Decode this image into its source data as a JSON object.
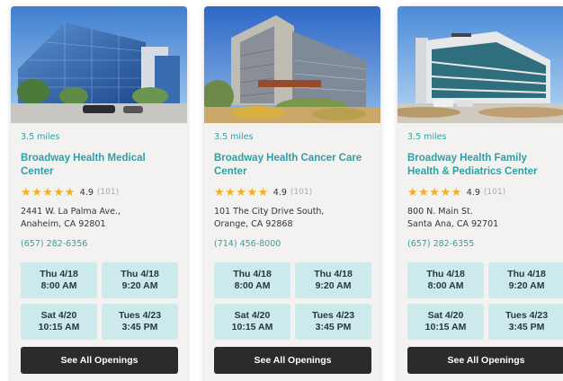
{
  "colors": {
    "accent": "#2f9fa6",
    "slot_bg": "#cce9ec",
    "star": "#f2b01e",
    "button_bg": "#2b2b2b"
  },
  "cards": [
    {
      "image": "building-photo",
      "distance": "3.5 miles",
      "name": "Broadway Health Medical Center",
      "stars": "★★★★★",
      "rating": "4.9",
      "reviews": "(101)",
      "address_line1": "2441 W. La Palma Ave.,",
      "address_line2": "Anaheim, CA 92801",
      "phone": "(657) 282-6356",
      "slots": [
        {
          "day": "Thu 4/18",
          "time": "8:00 AM"
        },
        {
          "day": "Thu 4/18",
          "time": "9:20 AM"
        },
        {
          "day": "Sat 4/20",
          "time": "10:15 AM"
        },
        {
          "day": "Tues 4/23",
          "time": "3:45 PM"
        }
      ],
      "button": "See All Openings"
    },
    {
      "image": "building-photo",
      "distance": "3.5 miles",
      "name": "Broadway Health Cancer Care Center",
      "stars": "★★★★★",
      "rating": "4.9",
      "reviews": "(101)",
      "address_line1": "101 The City Drive South,",
      "address_line2": "Orange, CA 92868",
      "phone": "(714) 456-8000",
      "slots": [
        {
          "day": "Thu 4/18",
          "time": "8:00 AM"
        },
        {
          "day": "Thu 4/18",
          "time": "9:20 AM"
        },
        {
          "day": "Sat 4/20",
          "time": "10:15 AM"
        },
        {
          "day": "Tues 4/23",
          "time": "3:45 PM"
        }
      ],
      "button": "See All Openings"
    },
    {
      "image": "building-photo",
      "distance": "3.5 miles",
      "name": "Broadway Health Family Health & Pediatrics Center",
      "stars": "★★★★★",
      "rating": "4.9",
      "reviews": "(101)",
      "address_line1": "800 N. Main St.",
      "address_line2": "Santa Ana, CA 92701",
      "phone": "(657) 282-6355",
      "slots": [
        {
          "day": "Thu 4/18",
          "time": "8:00 AM"
        },
        {
          "day": "Thu 4/18",
          "time": "9:20 AM"
        },
        {
          "day": "Sat 4/20",
          "time": "10:15 AM"
        },
        {
          "day": "Tues 4/23",
          "time": "3:45 PM"
        }
      ],
      "button": "See All Openings"
    }
  ]
}
